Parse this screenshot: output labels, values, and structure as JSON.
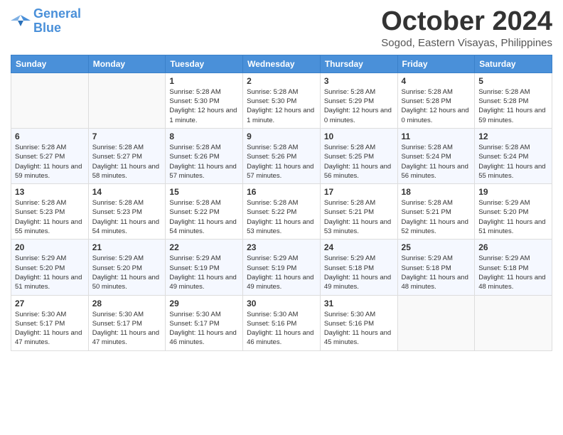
{
  "logo": {
    "line1": "General",
    "line2": "Blue"
  },
  "header": {
    "title": "October 2024",
    "subtitle": "Sogod, Eastern Visayas, Philippines"
  },
  "weekdays": [
    "Sunday",
    "Monday",
    "Tuesday",
    "Wednesday",
    "Thursday",
    "Friday",
    "Saturday"
  ],
  "weeks": [
    [
      {
        "day": "",
        "sunrise": "",
        "sunset": "",
        "daylight": ""
      },
      {
        "day": "",
        "sunrise": "",
        "sunset": "",
        "daylight": ""
      },
      {
        "day": "1",
        "sunrise": "Sunrise: 5:28 AM",
        "sunset": "Sunset: 5:30 PM",
        "daylight": "Daylight: 12 hours and 1 minute."
      },
      {
        "day": "2",
        "sunrise": "Sunrise: 5:28 AM",
        "sunset": "Sunset: 5:30 PM",
        "daylight": "Daylight: 12 hours and 1 minute."
      },
      {
        "day": "3",
        "sunrise": "Sunrise: 5:28 AM",
        "sunset": "Sunset: 5:29 PM",
        "daylight": "Daylight: 12 hours and 0 minutes."
      },
      {
        "day": "4",
        "sunrise": "Sunrise: 5:28 AM",
        "sunset": "Sunset: 5:28 PM",
        "daylight": "Daylight: 12 hours and 0 minutes."
      },
      {
        "day": "5",
        "sunrise": "Sunrise: 5:28 AM",
        "sunset": "Sunset: 5:28 PM",
        "daylight": "Daylight: 11 hours and 59 minutes."
      }
    ],
    [
      {
        "day": "6",
        "sunrise": "Sunrise: 5:28 AM",
        "sunset": "Sunset: 5:27 PM",
        "daylight": "Daylight: 11 hours and 59 minutes."
      },
      {
        "day": "7",
        "sunrise": "Sunrise: 5:28 AM",
        "sunset": "Sunset: 5:27 PM",
        "daylight": "Daylight: 11 hours and 58 minutes."
      },
      {
        "day": "8",
        "sunrise": "Sunrise: 5:28 AM",
        "sunset": "Sunset: 5:26 PM",
        "daylight": "Daylight: 11 hours and 57 minutes."
      },
      {
        "day": "9",
        "sunrise": "Sunrise: 5:28 AM",
        "sunset": "Sunset: 5:26 PM",
        "daylight": "Daylight: 11 hours and 57 minutes."
      },
      {
        "day": "10",
        "sunrise": "Sunrise: 5:28 AM",
        "sunset": "Sunset: 5:25 PM",
        "daylight": "Daylight: 11 hours and 56 minutes."
      },
      {
        "day": "11",
        "sunrise": "Sunrise: 5:28 AM",
        "sunset": "Sunset: 5:24 PM",
        "daylight": "Daylight: 11 hours and 56 minutes."
      },
      {
        "day": "12",
        "sunrise": "Sunrise: 5:28 AM",
        "sunset": "Sunset: 5:24 PM",
        "daylight": "Daylight: 11 hours and 55 minutes."
      }
    ],
    [
      {
        "day": "13",
        "sunrise": "Sunrise: 5:28 AM",
        "sunset": "Sunset: 5:23 PM",
        "daylight": "Daylight: 11 hours and 55 minutes."
      },
      {
        "day": "14",
        "sunrise": "Sunrise: 5:28 AM",
        "sunset": "Sunset: 5:23 PM",
        "daylight": "Daylight: 11 hours and 54 minutes."
      },
      {
        "day": "15",
        "sunrise": "Sunrise: 5:28 AM",
        "sunset": "Sunset: 5:22 PM",
        "daylight": "Daylight: 11 hours and 54 minutes."
      },
      {
        "day": "16",
        "sunrise": "Sunrise: 5:28 AM",
        "sunset": "Sunset: 5:22 PM",
        "daylight": "Daylight: 11 hours and 53 minutes."
      },
      {
        "day": "17",
        "sunrise": "Sunrise: 5:28 AM",
        "sunset": "Sunset: 5:21 PM",
        "daylight": "Daylight: 11 hours and 53 minutes."
      },
      {
        "day": "18",
        "sunrise": "Sunrise: 5:28 AM",
        "sunset": "Sunset: 5:21 PM",
        "daylight": "Daylight: 11 hours and 52 minutes."
      },
      {
        "day": "19",
        "sunrise": "Sunrise: 5:29 AM",
        "sunset": "Sunset: 5:20 PM",
        "daylight": "Daylight: 11 hours and 51 minutes."
      }
    ],
    [
      {
        "day": "20",
        "sunrise": "Sunrise: 5:29 AM",
        "sunset": "Sunset: 5:20 PM",
        "daylight": "Daylight: 11 hours and 51 minutes."
      },
      {
        "day": "21",
        "sunrise": "Sunrise: 5:29 AM",
        "sunset": "Sunset: 5:20 PM",
        "daylight": "Daylight: 11 hours and 50 minutes."
      },
      {
        "day": "22",
        "sunrise": "Sunrise: 5:29 AM",
        "sunset": "Sunset: 5:19 PM",
        "daylight": "Daylight: 11 hours and 49 minutes."
      },
      {
        "day": "23",
        "sunrise": "Sunrise: 5:29 AM",
        "sunset": "Sunset: 5:19 PM",
        "daylight": "Daylight: 11 hours and 49 minutes."
      },
      {
        "day": "24",
        "sunrise": "Sunrise: 5:29 AM",
        "sunset": "Sunset: 5:18 PM",
        "daylight": "Daylight: 11 hours and 49 minutes."
      },
      {
        "day": "25",
        "sunrise": "Sunrise: 5:29 AM",
        "sunset": "Sunset: 5:18 PM",
        "daylight": "Daylight: 11 hours and 48 minutes."
      },
      {
        "day": "26",
        "sunrise": "Sunrise: 5:29 AM",
        "sunset": "Sunset: 5:18 PM",
        "daylight": "Daylight: 11 hours and 48 minutes."
      }
    ],
    [
      {
        "day": "27",
        "sunrise": "Sunrise: 5:30 AM",
        "sunset": "Sunset: 5:17 PM",
        "daylight": "Daylight: 11 hours and 47 minutes."
      },
      {
        "day": "28",
        "sunrise": "Sunrise: 5:30 AM",
        "sunset": "Sunset: 5:17 PM",
        "daylight": "Daylight: 11 hours and 47 minutes."
      },
      {
        "day": "29",
        "sunrise": "Sunrise: 5:30 AM",
        "sunset": "Sunset: 5:17 PM",
        "daylight": "Daylight: 11 hours and 46 minutes."
      },
      {
        "day": "30",
        "sunrise": "Sunrise: 5:30 AM",
        "sunset": "Sunset: 5:16 PM",
        "daylight": "Daylight: 11 hours and 46 minutes."
      },
      {
        "day": "31",
        "sunrise": "Sunrise: 5:30 AM",
        "sunset": "Sunset: 5:16 PM",
        "daylight": "Daylight: 11 hours and 45 minutes."
      },
      {
        "day": "",
        "sunrise": "",
        "sunset": "",
        "daylight": ""
      },
      {
        "day": "",
        "sunrise": "",
        "sunset": "",
        "daylight": ""
      }
    ]
  ]
}
